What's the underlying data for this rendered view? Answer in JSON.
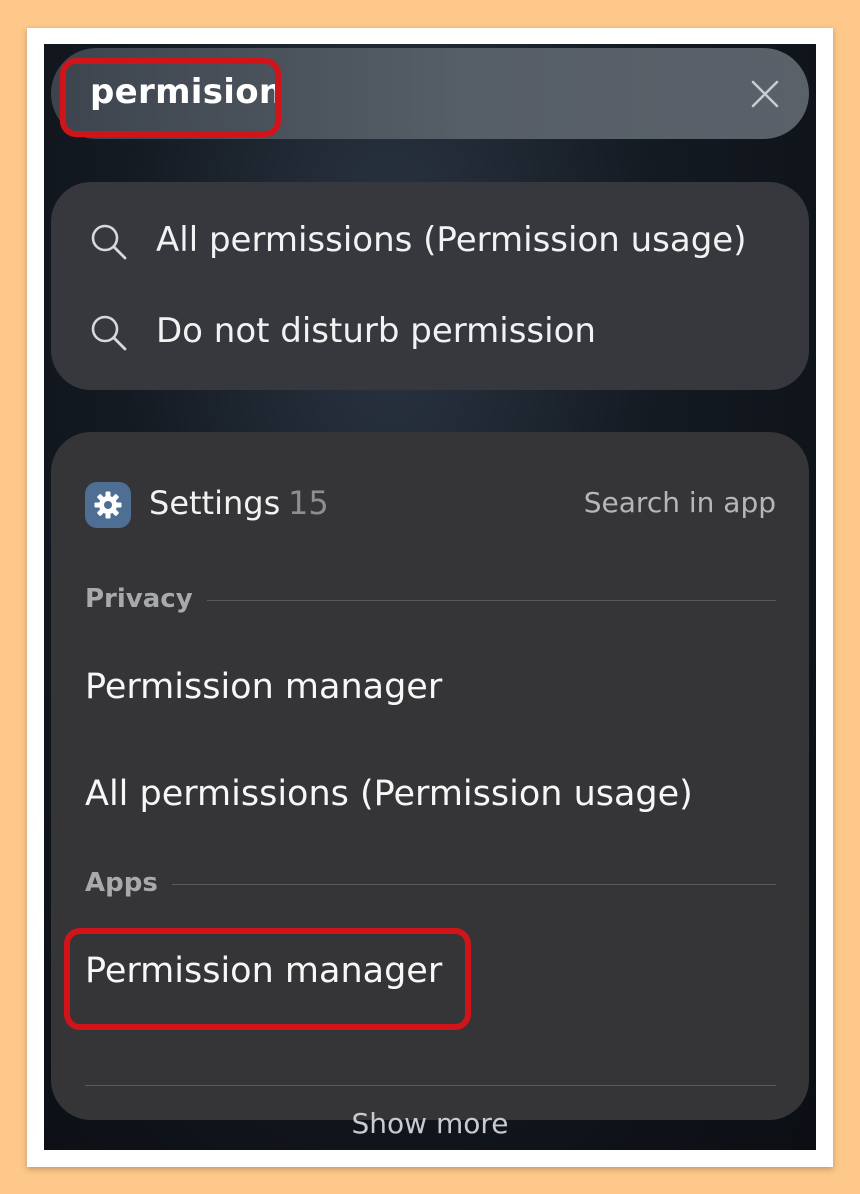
{
  "search": {
    "query": "permision"
  },
  "suggestions": [
    {
      "label": "All permissions (Permission usage)",
      "icon": "search-icon"
    },
    {
      "label": "Do not disturb permission",
      "icon": "search-icon"
    }
  ],
  "settings_result": {
    "app_name": "Settings",
    "count": "15",
    "search_in_app": "Search in app",
    "icon": "gear-icon",
    "sections": [
      {
        "title": "Privacy",
        "items": [
          "Permission manager",
          "All permissions (Permission usage)"
        ]
      },
      {
        "title": "Apps",
        "items": [
          "Permission manager"
        ]
      }
    ],
    "show_more": "Show more"
  },
  "colors": {
    "outer_background": "#fdc88a",
    "highlight": "#d0141a",
    "app_icon": "#4e6f93"
  }
}
